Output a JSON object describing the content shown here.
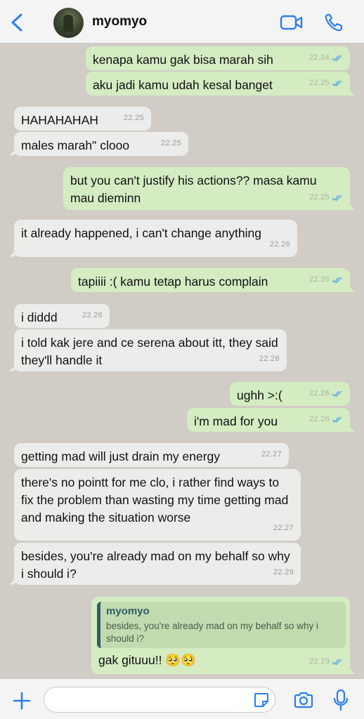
{
  "header": {
    "contact_name": "myomyo"
  },
  "messages": [
    {
      "dir": "out",
      "text": "kenapa kamu gak bisa marah sih",
      "time": "22.24",
      "ticks": true
    },
    {
      "dir": "out",
      "text": "aku jadi kamu udah kesal banget",
      "time": "22.25",
      "ticks": true
    },
    {
      "dir": "in",
      "text": "HAHAHAHAH",
      "time": "22.25"
    },
    {
      "dir": "in",
      "text": "males marah\" clooo",
      "time": "22.25"
    },
    {
      "dir": "out",
      "text": "but you can't justify his actions?? masa kamu mau dieminn",
      "time": "22.25",
      "ticks": true
    },
    {
      "dir": "in",
      "text": "it already happened, i can't change anything",
      "time": "22.26"
    },
    {
      "dir": "out",
      "text": "tapiiii :( kamu tetap harus complain",
      "time": "22.26",
      "ticks": true
    },
    {
      "dir": "in",
      "text": "i diddd",
      "time": "22.26"
    },
    {
      "dir": "in",
      "text": "i told kak jere and ce serena about itt, they said they'll handle it",
      "time": "22.26"
    },
    {
      "dir": "out",
      "text": "ughh >:(",
      "time": "22.26",
      "ticks": true
    },
    {
      "dir": "out",
      "text": "i'm mad for you",
      "time": "22.26",
      "ticks": true
    },
    {
      "dir": "in",
      "text": "getting mad will just drain my energy",
      "time": "22.27"
    },
    {
      "dir": "in",
      "text": "there's no pointt for me clo, i rather find ways to fix the problem than wasting my time getting mad and making the situation worse",
      "time": "22.27"
    },
    {
      "dir": "in",
      "text": "besides, you're already mad on my behalf so why i should i?",
      "time": "22.29"
    },
    {
      "dir": "out",
      "text": "gak gituuu!! 🥺🥺",
      "time": "22.29",
      "ticks": true,
      "quote": {
        "author": "myomyo",
        "text": "besides, you're already mad on my behalf so why i should i?"
      }
    }
  ],
  "composer": {
    "value": "",
    "placeholder": ""
  },
  "icons": {
    "back": "chevron-left-icon",
    "video": "video-call-icon",
    "phone": "phone-icon",
    "add": "plus-icon",
    "sticker": "sticker-icon",
    "camera": "camera-icon",
    "mic": "microphone-icon"
  },
  "colors": {
    "accent": "#2a7ef0",
    "incoming_bubble": "#ececea",
    "outgoing_bubble": "#d5ecc3",
    "chat_background": "#d1ccc5",
    "read_ticks": "#4fa3e0"
  }
}
